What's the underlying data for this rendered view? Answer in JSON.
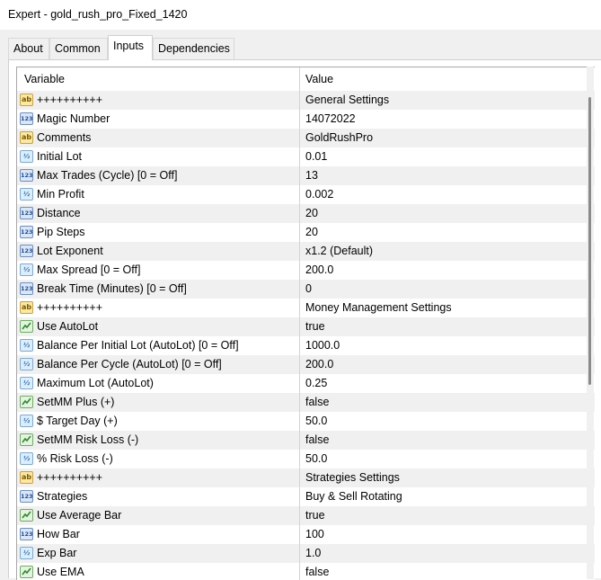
{
  "window": {
    "title": "Expert - gold_rush_pro_Fixed_1420"
  },
  "tabs": [
    "About",
    "Common",
    "Inputs",
    "Dependencies"
  ],
  "active_tab": "Inputs",
  "table": {
    "columns": [
      "Variable",
      "Value"
    ],
    "rows": [
      {
        "icon": "ab",
        "variable": "++++++++++",
        "value": "General Settings"
      },
      {
        "icon": "123",
        "variable": "Magic Number",
        "value": "14072022"
      },
      {
        "icon": "ab",
        "variable": "Comments",
        "value": "GoldRushPro"
      },
      {
        "icon": "1/2",
        "variable": "Initial Lot",
        "value": "0.01"
      },
      {
        "icon": "123",
        "variable": "Max Trades (Cycle) [0 = Off]",
        "value": "13"
      },
      {
        "icon": "1/2",
        "variable": "Min Profit",
        "value": "0.002"
      },
      {
        "icon": "123",
        "variable": "Distance",
        "value": "20"
      },
      {
        "icon": "123",
        "variable": "Pip Steps",
        "value": "20"
      },
      {
        "icon": "123",
        "variable": "Lot Exponent",
        "value": "x1.2 (Default)"
      },
      {
        "icon": "1/2",
        "variable": "Max Spread [0 = Off]",
        "value": "200.0"
      },
      {
        "icon": "123",
        "variable": "Break Time (Minutes) [0 = Off]",
        "value": "0"
      },
      {
        "icon": "ab",
        "variable": "++++++++++",
        "value": "Money Management Settings"
      },
      {
        "icon": "bool",
        "variable": "Use AutoLot",
        "value": "true"
      },
      {
        "icon": "1/2",
        "variable": "Balance Per Initial Lot (AutoLot) [0 = Off]",
        "value": "1000.0"
      },
      {
        "icon": "1/2",
        "variable": "Balance Per Cycle (AutoLot) [0 = Off]",
        "value": "200.0"
      },
      {
        "icon": "1/2",
        "variable": "Maximum Lot (AutoLot)",
        "value": "0.25"
      },
      {
        "icon": "bool",
        "variable": "SetMM Plus (+)",
        "value": "false"
      },
      {
        "icon": "1/2",
        "variable": "$ Target Day (+)",
        "value": "50.0"
      },
      {
        "icon": "bool",
        "variable": "SetMM Risk Loss (-)",
        "value": "false"
      },
      {
        "icon": "1/2",
        "variable": "% Risk Loss (-)",
        "value": "50.0"
      },
      {
        "icon": "ab",
        "variable": "++++++++++",
        "value": "Strategies Settings"
      },
      {
        "icon": "123",
        "variable": "Strategies",
        "value": "Buy & Sell Rotating"
      },
      {
        "icon": "bool",
        "variable": "Use Average Bar",
        "value": "true"
      },
      {
        "icon": "123",
        "variable": "How Bar",
        "value": "100"
      },
      {
        "icon": "1/2",
        "variable": "Exp Bar",
        "value": "1.0"
      },
      {
        "icon": "bool",
        "variable": "Use EMA",
        "value": "false"
      }
    ]
  }
}
